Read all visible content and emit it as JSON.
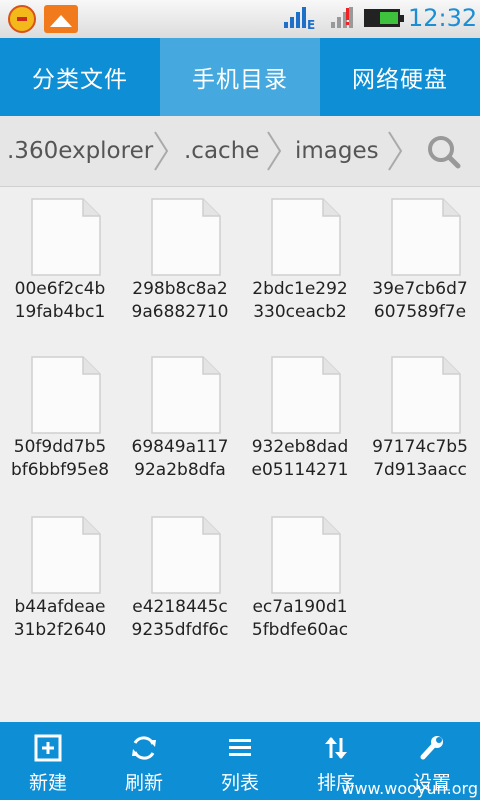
{
  "status_bar": {
    "time": "12:32",
    "network_type": "E",
    "icons": [
      "app-360-icon",
      "gallery-icon",
      "signal-icon",
      "signal-no-service-icon",
      "battery-icon"
    ]
  },
  "tabs": [
    {
      "label": "分类文件",
      "active": false
    },
    {
      "label": "手机目录",
      "active": true
    },
    {
      "label": "网络硬盘",
      "active": false
    }
  ],
  "breadcrumb": [
    ".360explorer",
    ".cache",
    "images"
  ],
  "files": [
    {
      "line1": "00e6f2c4b",
      "line2": "19fab4bc1"
    },
    {
      "line1": "298b8c8a2",
      "line2": "9a6882710"
    },
    {
      "line1": "2bdc1e292",
      "line2": "330ceacb2"
    },
    {
      "line1": "39e7cb6d7",
      "line2": "607589f7e"
    },
    {
      "line1": "50f9dd7b5",
      "line2": "bf6bbf95e8"
    },
    {
      "line1": "69849a117",
      "line2": "92a2b8dfa"
    },
    {
      "line1": "932eb8dad",
      "line2": "e05114271"
    },
    {
      "line1": "97174c7b5",
      "line2": "7d913aacc"
    },
    {
      "line1": "b44afdeae",
      "line2": "31b2f2640"
    },
    {
      "line1": "e4218445c",
      "line2": "9235dfdf6c"
    },
    {
      "line1": "ec7a190d1",
      "line2": "5fbdfe60ac"
    }
  ],
  "toolbar": [
    {
      "label": "新建",
      "icon": "new-icon"
    },
    {
      "label": "刷新",
      "icon": "refresh-icon"
    },
    {
      "label": "列表",
      "icon": "list-icon"
    },
    {
      "label": "排序",
      "icon": "sort-icon"
    },
    {
      "label": "设置",
      "icon": "settings-icon"
    }
  ],
  "watermark": "www.wooyun.org",
  "colors": {
    "accent": "#0e8ed4",
    "active_tab": "#45a9df",
    "time": "#1a8fd6"
  }
}
